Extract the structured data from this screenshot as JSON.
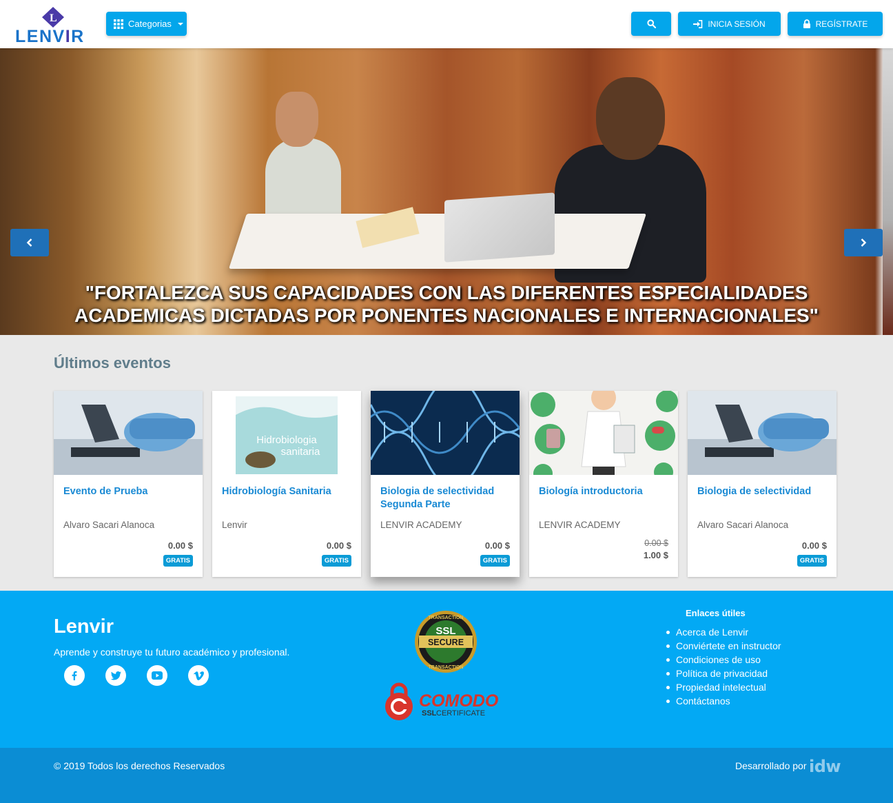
{
  "header": {
    "logo_text_a": "LENV",
    "logo_text_b": "I",
    "logo_text_c": "R",
    "logo_mark_letter": "L",
    "categories_label": "Categorias",
    "login_label": "Inicia sesión",
    "register_label": "Regístrate",
    "icons": {
      "categories": "grid-icon",
      "search": "search-icon",
      "login": "sign-in-icon",
      "register": "lock-icon"
    },
    "accent_color": "#03a6eb"
  },
  "hero": {
    "caption_line1": "\"FORTALEZCA SUS CAPACIDADES CON LAS DIFERENTES ESPECIALIDADES",
    "caption_line2": "ACADEMICAS DICTADAS POR PONENTES NACIONALES E INTERNACIONALES\""
  },
  "events": {
    "title": "Últimos eventos",
    "cards": [
      {
        "title": "Evento de Prueba",
        "author": "Alvaro Sacari Alanoca",
        "price": "0.00 $",
        "badge": "GRATIS",
        "image": "microscope-image"
      },
      {
        "title": "Hidrobiología Sanitaria",
        "author": "Lenvir",
        "price": "0.00 $",
        "badge": "GRATIS",
        "image": "hidrobiologia-image",
        "image_text_1": "Hidrobiologia",
        "image_text_2": "sanitaria"
      },
      {
        "title": "Biologia de selectividad Segunda Parte",
        "author": "LENVIR ACADEMY",
        "price": "0.00 $",
        "badge": "GRATIS",
        "image": "dna-image"
      },
      {
        "title": "Biología introductoria",
        "author": "LENVIR ACADEMY",
        "old_price": "0.00 $",
        "price": "1.00 $",
        "image": "doctor-illustration-image"
      },
      {
        "title": "Biologia de selectividad",
        "author": "Alvaro Sacari Alanoca",
        "price": "0.00 $",
        "badge": "GRATIS",
        "image": "microscope-image"
      }
    ]
  },
  "footer": {
    "brand": "Lenvir",
    "tagline": "Aprende y construye tu futuro académico y profesional.",
    "social": [
      "facebook-icon",
      "twitter-icon",
      "youtube-icon",
      "vimeo-icon"
    ],
    "ssl_badge": {
      "top": "TRANSACTION",
      "line1": "SSL",
      "line2": "SECURE",
      "bottom": "TRANSACTION"
    },
    "comodo": {
      "name": "COMODO",
      "sub_a": "SSL",
      "sub_b": "CERTIFICATE"
    },
    "links_title": "Enlaces útiles",
    "links": [
      "Acerca de Lenvir",
      "Conviértete en instructor",
      "Condiciones de uso",
      "Política de privacidad",
      "Propiedad intelectual",
      "Contáctanos"
    ],
    "copyright": "© 2019 Todos los derechos Reservados",
    "developed_by": "Desarrollado por",
    "developer_logo": "idw",
    "footer_color": "#03a9f4",
    "bottom_color": "#0b8dd4"
  }
}
